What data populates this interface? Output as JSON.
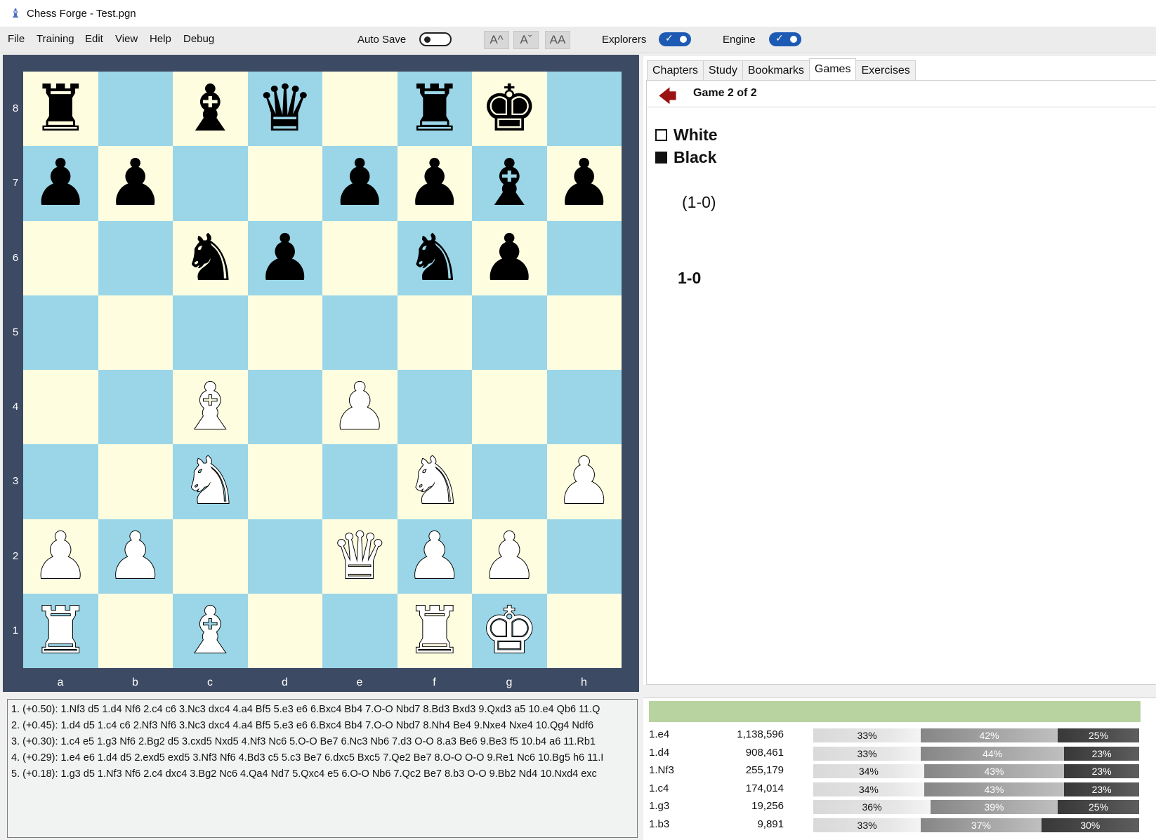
{
  "window": {
    "title": "Chess Forge - Test.pgn"
  },
  "menu": [
    "File",
    "Training",
    "Edit",
    "View",
    "Help",
    "Debug"
  ],
  "toolbar": {
    "auto_save_label": "Auto Save",
    "auto_save_on": false,
    "font_buttons": [
      "A^",
      "Aˇ",
      "AA"
    ],
    "explorers_label": "Explorers",
    "explorers_on": true,
    "engine_label": "Engine",
    "engine_on": true,
    "toggle_check": "✓",
    "toggle_color": "#1c5ab4"
  },
  "board": {
    "ranks": [
      "8",
      "7",
      "6",
      "5",
      "4",
      "3",
      "2",
      "1"
    ],
    "files": [
      "a",
      "b",
      "c",
      "d",
      "e",
      "f",
      "g",
      "h"
    ],
    "fen_rows": [
      "r1bq1rk1",
      "pp2ppbp",
      "2np1np1",
      "8",
      "2B1P3",
      "2N2N1P",
      "PP2QPP1",
      "R1B2RK1"
    ],
    "light_color": "#fffde0",
    "dark_color": "#9ad6e8",
    "frame_color": "#3d4a63"
  },
  "tabs": [
    {
      "label": "Chapters",
      "active": false
    },
    {
      "label": "Study",
      "active": false
    },
    {
      "label": "Bookmarks",
      "active": false
    },
    {
      "label": "Games",
      "active": true
    },
    {
      "label": "Exercises",
      "active": false
    }
  ],
  "game": {
    "counter": "Game 2 of 2",
    "white": "White",
    "black": "Black",
    "result_header": "(1-0)",
    "result": "1-0"
  },
  "engine_lines": [
    "1. (+0.50): 1.Nf3 d5 1.d4 Nf6 2.c4 c6 3.Nc3 dxc4 4.a4 Bf5 5.e3 e6 6.Bxc4 Bb4 7.O-O Nbd7 8.Bd3 Bxd3 9.Qxd3 a5 10.e4 Qb6 11.Q",
    "2. (+0.45): 1.d4 d5 1.c4 c6 2.Nf3 Nf6 3.Nc3 dxc4 4.a4 Bf5 5.e3 e6 6.Bxc4 Bb4 7.O-O Nbd7 8.Nh4 Be4 9.Nxe4 Nxe4 10.Qg4 Ndf6",
    "3. (+0.30): 1.c4 e5 1.g3 Nf6 2.Bg2 d5 3.cxd5 Nxd5 4.Nf3 Nc6 5.O-O Be7 6.Nc3 Nb6 7.d3 O-O 8.a3 Be6 9.Be3 f5 10.b4 a6 11.Rb1",
    "4. (+0.29): 1.e4 e6 1.d4 d5 2.exd5 exd5 3.Nf3 Nf6 4.Bd3 c5 5.c3 Be7 6.dxc5 Bxc5 7.Qe2 Be7 8.O-O O-O 9.Re1 Nc6 10.Bg5 h6 11.I",
    "5. (+0.18): 1.g3 d5 1.Nf3 Nf6 2.c4 dxc4 3.Bg2 Nc6 4.Qa4 Nd7 5.Qxc4 e5 6.O-O Nb6 7.Qc2 Be7 8.b3 O-O 9.Bb2 Nd4 10.Nxd4 exc"
  ],
  "explorer": {
    "header_color": "#b9d3a0",
    "moves": [
      {
        "move": "1.e4",
        "count": "1,138,596",
        "white": 33,
        "draw": 42,
        "black": 25
      },
      {
        "move": "1.d4",
        "count": "908,461",
        "white": 33,
        "draw": 44,
        "black": 23
      },
      {
        "move": "1.Nf3",
        "count": "255,179",
        "white": 34,
        "draw": 43,
        "black": 23
      },
      {
        "move": "1.c4",
        "count": "174,014",
        "white": 34,
        "draw": 43,
        "black": 23
      },
      {
        "move": "1.g3",
        "count": "19,256",
        "white": 36,
        "draw": 39,
        "black": 25
      },
      {
        "move": "1.b3",
        "count": "9,891",
        "white": 33,
        "draw": 37,
        "black": 30
      }
    ]
  }
}
